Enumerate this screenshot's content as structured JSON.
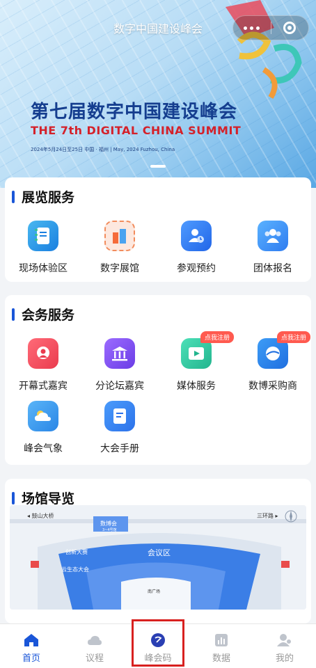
{
  "banner": {
    "title": "数字中国建设峰会",
    "headline": "第七届数字中国建设峰会",
    "subheadline": "THE 7th DIGITAL CHINA SUMMIT",
    "meta": "2024年5月24日至25日  中国 · 福州  |  May, 2024 Fuzhou, China"
  },
  "exhibition": {
    "title": "展览服务",
    "items": [
      {
        "label": "现场体验区",
        "icon": "book-icon"
      },
      {
        "label": "数字展馆",
        "icon": "building-icon"
      },
      {
        "label": "参观预约",
        "icon": "user-clock-icon"
      },
      {
        "label": "团体报名",
        "icon": "group-icon"
      }
    ]
  },
  "conference": {
    "title": "会务服务",
    "items": [
      {
        "label": "开幕式嘉宾",
        "icon": "guest-icon"
      },
      {
        "label": "分论坛嘉宾",
        "icon": "hall-icon"
      },
      {
        "label": "媒体服务",
        "icon": "play-icon",
        "badge": "点我注册"
      },
      {
        "label": "数博采购商",
        "icon": "globe-icon",
        "badge": "点我注册"
      },
      {
        "label": "峰会气象",
        "icon": "cloud-icon"
      },
      {
        "label": "大会手册",
        "icon": "manual-icon"
      }
    ]
  },
  "venue": {
    "title": "场馆导览",
    "labels": {
      "left_road": "◂ 鼓山大桥",
      "right_road": "三环路 ▸",
      "center": "会议区",
      "hall_top": "数博会",
      "hall_sub": "3~4号馆",
      "innovation": "创新大赛",
      "eco": "云生态大会",
      "plaza": "南广场"
    }
  },
  "tabbar": {
    "tabs": [
      {
        "label": "首页",
        "active": true
      },
      {
        "label": "议程",
        "active": false
      },
      {
        "label": "峰会码",
        "active": false
      },
      {
        "label": "数据",
        "active": false
      },
      {
        "label": "我的",
        "active": false
      }
    ]
  },
  "colors": {
    "accent": "#1a56d8",
    "highlight": "#d8201f",
    "badge": "#ff5a4f"
  }
}
